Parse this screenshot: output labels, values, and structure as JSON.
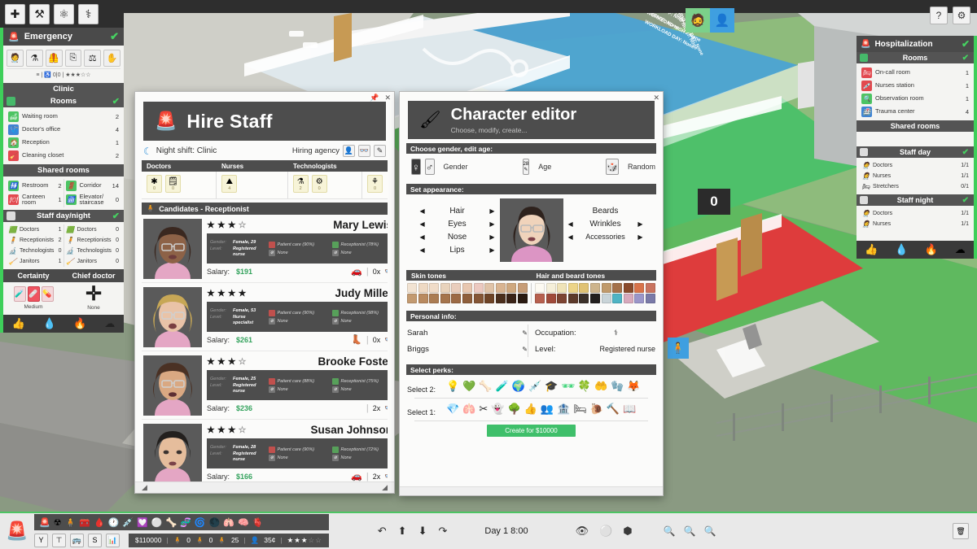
{
  "topbar": {
    "tools": [
      {
        "name": "medical-cross-tool",
        "glyph": "✚"
      },
      {
        "name": "build-hammer-tool",
        "glyph": "⚒"
      },
      {
        "name": "staff-group-tool",
        "glyph": "⚛"
      },
      {
        "name": "stethoscope-tool",
        "glyph": "⚕"
      }
    ]
  },
  "corner_buttons": [
    {
      "name": "help-button",
      "glyph": "?"
    },
    {
      "name": "settings-button",
      "glyph": "⚙"
    }
  ],
  "left_panel": {
    "department": "Emergency",
    "check": "✔",
    "room_tools": [
      "⚕",
      "⚗",
      "⬛",
      "⎘",
      "⚖",
      "✋"
    ],
    "mini_stats": "≡  |  ♿ 0|0  |  ★★★☆☆",
    "clinic_label": "Clinic",
    "rooms_header": "Rooms",
    "rooms": [
      {
        "name": "Waiting room",
        "count": "2",
        "color": "#4cc463"
      },
      {
        "name": "Doctor's office",
        "count": "4",
        "color": "#3f84d4"
      },
      {
        "name": "Reception",
        "count": "1",
        "color": "#4cc463"
      },
      {
        "name": "Cleaning closet",
        "count": "2",
        "color": "#e2494f"
      }
    ],
    "shared_rooms_header": "Shared rooms",
    "shared_rooms_left": [
      {
        "name": "Restroom",
        "count": "2",
        "color": "#4cc463"
      },
      {
        "name": "Canteen room",
        "count": "1",
        "color": "#e2494f"
      }
    ],
    "shared_rooms_right": [
      {
        "name": "Corridor",
        "count": "14",
        "color": "#4cc463"
      },
      {
        "name": "Elevator/ staircase",
        "count": "0",
        "color": "#4cc463"
      }
    ],
    "staff_header": "Staff day/night",
    "staff_day": [
      {
        "name": "Doctors",
        "count": "1"
      },
      {
        "name": "Receptionists",
        "count": "2"
      },
      {
        "name": "Technologists",
        "count": "0"
      },
      {
        "name": "Janitors",
        "count": "1"
      }
    ],
    "staff_night": [
      {
        "name": "Doctors",
        "count": "0"
      },
      {
        "name": "Receptionists",
        "count": "0"
      },
      {
        "name": "Technologists",
        "count": "0"
      },
      {
        "name": "Janitors",
        "count": "0"
      }
    ],
    "certainty_label": "Certainty",
    "chief_doctor_label": "Chief doctor",
    "certainty_value": "Medium",
    "chief_doctor_value": "None",
    "footer_icons": [
      "👍",
      "💧",
      "🔥",
      "☁"
    ]
  },
  "right_panel": {
    "title": "Hospitalization",
    "check": "✔",
    "rooms_header": "Rooms",
    "rooms": [
      {
        "name": "On-call room",
        "count": "1",
        "color": "#e2494f"
      },
      {
        "name": "Nurses station",
        "count": "1",
        "color": "#e2494f"
      },
      {
        "name": "Observation room",
        "count": "1",
        "color": "#4cc463"
      },
      {
        "name": "Trauma center",
        "count": "4",
        "color": "#3f84d4"
      }
    ],
    "shared_rooms_header": "Shared rooms",
    "staff_day_header": "Staff day",
    "staff_day": [
      {
        "name": "Doctors",
        "count": "1/1"
      },
      {
        "name": "Nurses",
        "count": "1/1"
      },
      {
        "name": "Stretchers",
        "count": "0/1"
      }
    ],
    "staff_night_header": "Staff night",
    "staff_night": [
      {
        "name": "Doctors",
        "count": "1/1"
      },
      {
        "name": "Nurses",
        "count": "1/1"
      }
    ],
    "footer_icons": [
      "👍",
      "💧",
      "🔥",
      "☁"
    ]
  },
  "hire_staff": {
    "title": "Hire Staff",
    "shift": "Night shift: Clinic",
    "agency_label": "Hiring agency",
    "agency_buttons": [
      "👤",
      "👓",
      "✎"
    ],
    "professions": [
      {
        "label": "Doctors",
        "icons": [
          {
            "glyph": "✱",
            "count": "0"
          },
          {
            "glyph": "🗒",
            "count": "0"
          }
        ]
      },
      {
        "label": "Nurses",
        "icons": [
          {
            "glyph": "⛰",
            "count": "4"
          }
        ]
      },
      {
        "label": "Technologists",
        "icons": [
          {
            "glyph": "⚗",
            "count": "2"
          },
          {
            "glyph": "⚙",
            "count": "0"
          }
        ]
      },
      {
        "label": "",
        "icons": [
          {
            "glyph": "⚘",
            "count": "0"
          }
        ]
      }
    ],
    "candidates_header": "Candidates - Receptionist",
    "labels": {
      "gender": "Gender:",
      "level": "Level:",
      "salary": "Salary:"
    },
    "candidates": [
      {
        "name": "Mary Lewis",
        "stars": [
          "★",
          "★",
          "★"
        ],
        "star_extra": "☆",
        "gender": "Female, 29",
        "level": "Registered nurse",
        "skill1": "Patient care (90%)",
        "skill2": "Receptionist (78%)",
        "skill3": "None",
        "skill4": "None",
        "salary": "$191",
        "traits": [
          "🚗"
        ],
        "multiplier": "0x",
        "glasses": "👓",
        "skin": "#8d6247",
        "hair": "#3a2820",
        "shirt": "#e4a6c4"
      },
      {
        "name": "Judy Miller",
        "stars": [
          "★",
          "★",
          "★"
        ],
        "star_extra": "★",
        "gender": "Female, 53",
        "level": "Nurse specialist",
        "skill1": "Patient care (90%)",
        "skill2": "Receptionist (98%)",
        "skill3": "None",
        "skill4": "None",
        "salary": "$261",
        "traits": [
          "👢"
        ],
        "multiplier": "0x",
        "glasses": "👓",
        "skin": "#e9c3a7",
        "hair": "#c7a756",
        "shirt": "#e4a6c4"
      },
      {
        "name": "Brooke Foster",
        "stars": [
          "★",
          "★",
          "★"
        ],
        "star_extra": "☆",
        "gender": "Female, 25",
        "level": "Registered nurse",
        "skill1": "Patient care (88%)",
        "skill2": "Receptionist (75%)",
        "skill3": "None",
        "skill4": "None",
        "salary": "$236",
        "traits": [],
        "multiplier": "2x",
        "glasses": "👓",
        "skin": "#d9a882",
        "hair": "#4a3124",
        "shirt": "#e4a6c4"
      },
      {
        "name": "Susan Johnson",
        "stars": [
          "★",
          "★",
          "★"
        ],
        "star_extra": "☆",
        "gender": "Female, 28",
        "level": "Registered nurse",
        "skill1": "Patient care (90%)",
        "skill2": "Receptionist (72%)",
        "skill3": "None",
        "skill4": "None",
        "salary": "$166",
        "traits": [
          "🚗"
        ],
        "multiplier": "2x",
        "glasses": "👓",
        "skin": "#e5bd9c",
        "hair": "#23201e",
        "shirt": "#e4a6c4"
      }
    ]
  },
  "character_editor": {
    "title": "Character editor",
    "subtitle": "Choose, modify, create...",
    "gender_section": "Choose gender, edit age:",
    "gender_label": "Gender",
    "age_label": "Age",
    "age_value": "28",
    "random_label": "Random",
    "appearance_section": "Set appearance:",
    "left_features": [
      "Hair",
      "Eyes",
      "Nose",
      "Lips"
    ],
    "right_features": [
      "Beards",
      "Wrinkles",
      "Accessories"
    ],
    "skin_tones_label": "Skin tones",
    "hair_tones_label": "Hair and beard tones",
    "skin_tones": [
      "#f2e3d2",
      "#eed9c3",
      "#f0dcc8",
      "#e9d3bc",
      "#e9cdbc",
      "#e8c7b0",
      "#ecc9c0",
      "#e0c3a8",
      "#d9b491",
      "#cfa87f",
      "#c79d77",
      "#c39a70",
      "#b98a5f",
      "#ab7c52",
      "#a5744c",
      "#9c6a45",
      "#8f5f3c",
      "#855636",
      "#6e4427",
      "#4b2f1d",
      "#3a2317",
      "#2a1a11"
    ],
    "hair_tones": [
      "#fdfaf2",
      "#f5efd9",
      "#efe3b8",
      "#ecd488",
      "#e0c273",
      "#cdb48c",
      "#c09a6b",
      "#a4714a",
      "#8a4b2c",
      "#d8734a",
      "#c9735f",
      "#b7604f",
      "#a04a3a",
      "#7d4432",
      "#5c3a2a",
      "#3b3029",
      "#221f1e",
      "#c9d4d8",
      "#4fb4c4",
      "#d7a9bc",
      "#9b96c9",
      "#7a7aa8"
    ],
    "personal_info_label": "Personal info:",
    "first_name": "Sarah",
    "last_name": "Briggs",
    "occupation_label": "Occupation:",
    "occupation_icon": "⚕",
    "level_label": "Level:",
    "level_value": "Registered nurse",
    "perks_label": "Select perks:",
    "select2_label": "Select 2:",
    "select1_label": "Select 1:",
    "perks_green": [
      "💡",
      "💚",
      "🦴",
      "🧪",
      "🌍",
      "💉",
      "🎓",
      "🕶",
      "🍀",
      "🤲"
    ],
    "perks_yellow": [
      "🧤",
      "🦊"
    ],
    "perks_dark": [
      "💎",
      "🫁",
      "✂",
      "👻",
      "🌳",
      "👍",
      "👥",
      "🏦",
      "🛏",
      "🐌",
      "🔨",
      "📖"
    ],
    "create_button": "Create for $10000"
  },
  "bottom_bar": {
    "icon_strip": [
      "🚨",
      "☢",
      "🧍",
      "🧰",
      "🩸",
      "🕐",
      "💉",
      "💟",
      "⚪",
      "🦴",
      "🧬",
      "🌀",
      "🌑",
      "🫁",
      "🧠",
      "🫀"
    ],
    "quick_buttons": [
      "Y",
      "⊤",
      "🚌",
      "S",
      "📊"
    ],
    "money": "$110000",
    "patients_in": "0",
    "patients_crit": "0",
    "staff_count": "25",
    "reputation": "35¢",
    "stars_filled": 3,
    "stars_total": 5,
    "speed_controls": [
      "↶",
      "⬆",
      "⬇",
      "↷"
    ],
    "day_time": "Day 1  8:00",
    "view_icons": [
      "👁",
      "⚪",
      "⬢"
    ],
    "zoom_icons": [
      "🔍",
      "🔍",
      "🔍"
    ]
  },
  "world": {
    "counter_value": "0",
    "annotations": [
      "NIGHT STAFF: None",
      "DAY STAFF: None",
      "WORKLOAD NIGHT: None",
      "WORKLOAD DAY: None"
    ]
  }
}
